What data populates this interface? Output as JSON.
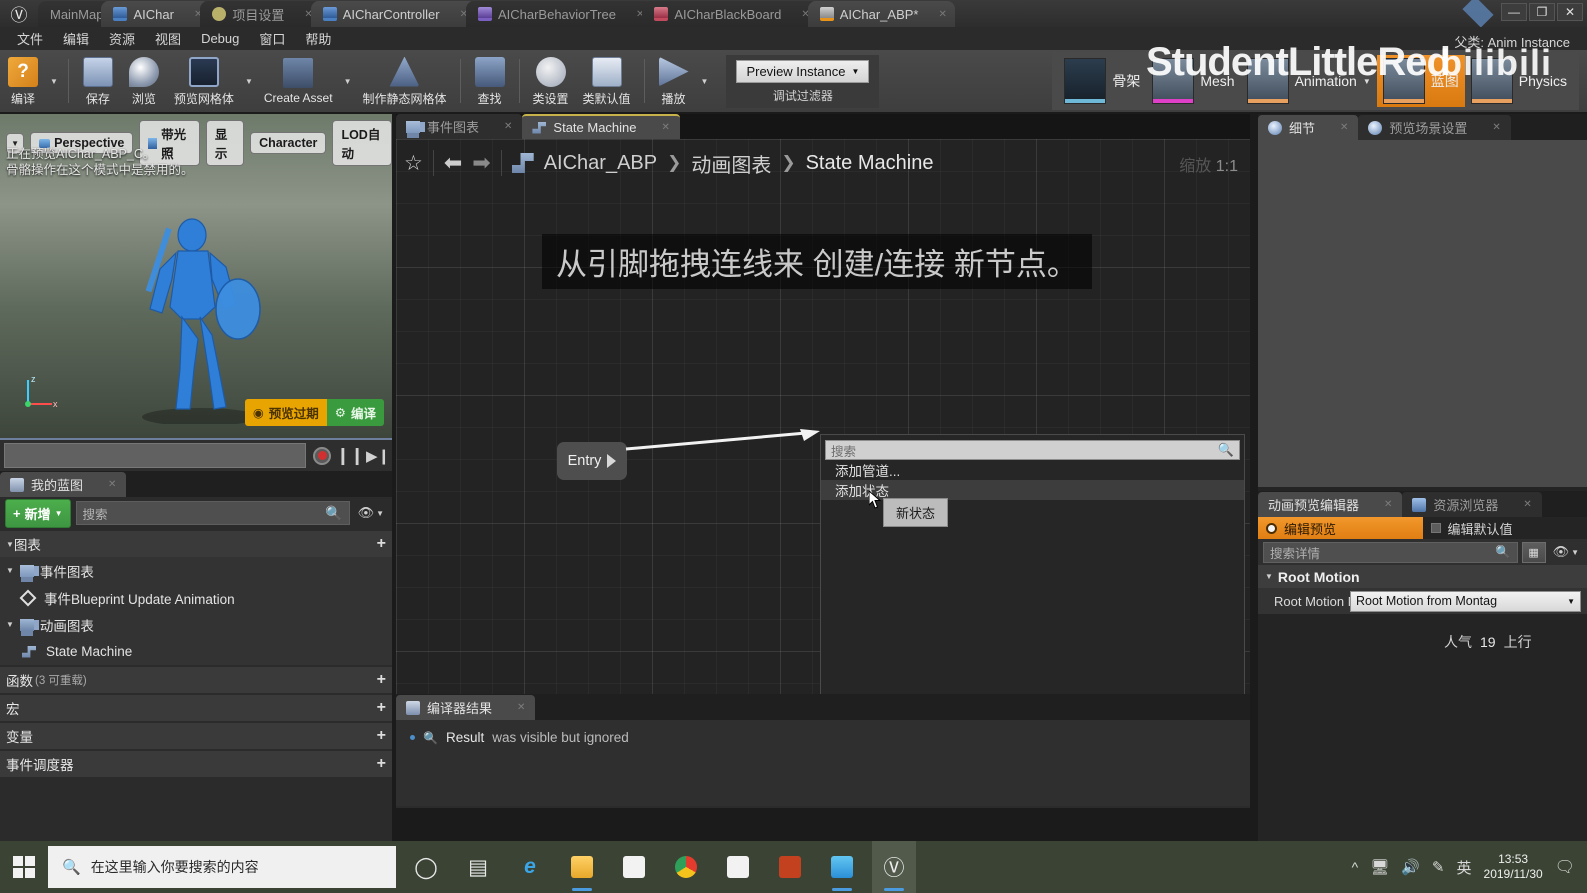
{
  "window": {
    "tabs": [
      {
        "label": "MainMap",
        "icon": "map-tab-icon",
        "active": false,
        "closable": false
      },
      {
        "label": "AIChar",
        "icon": "blueprint-tab-icon",
        "active": true,
        "closable": true
      },
      {
        "label": "项目设置",
        "icon": "settings-tab-icon",
        "active": false,
        "closable": true
      },
      {
        "label": "AICharController",
        "icon": "blueprint-tab-icon",
        "active": true,
        "closable": true
      },
      {
        "label": "AICharBehaviorTree",
        "icon": "behaviortree-tab-icon",
        "active": false,
        "closable": true
      },
      {
        "label": "AICharBlackBoard",
        "icon": "blackboard-tab-icon",
        "active": false,
        "closable": true
      },
      {
        "label": "AIChar_ABP*",
        "icon": "animbp-tab-icon",
        "active": true,
        "closable": true
      }
    ],
    "controls": {
      "minimize": "—",
      "maximize": "❐",
      "close": "✕"
    }
  },
  "menubar": {
    "items": [
      "文件",
      "编辑",
      "资源",
      "视图",
      "Debug",
      "窗口",
      "帮助"
    ],
    "right_label": "父类: Anim Instance"
  },
  "toolbar": {
    "items": [
      {
        "label": "编译",
        "icon": "compile-icon",
        "has_arrow": true
      },
      {
        "label": "保存",
        "icon": "save-icon",
        "has_arrow": false
      },
      {
        "label": "浏览",
        "icon": "browse-icon",
        "has_arrow": false
      },
      {
        "label": "预览网格体",
        "icon": "preview-mesh-icon",
        "has_arrow": true
      },
      {
        "label": "Create Asset",
        "icon": "create-asset-icon",
        "has_arrow": true
      },
      {
        "label": "制作静态网格体",
        "icon": "make-static-mesh-icon",
        "has_arrow": false
      },
      {
        "label": "查找",
        "icon": "find-icon",
        "has_arrow": false
      },
      {
        "label": "类设置",
        "icon": "class-settings-icon",
        "has_arrow": false
      },
      {
        "label": "类默认值",
        "icon": "class-defaults-icon",
        "has_arrow": false
      },
      {
        "label": "播放",
        "icon": "play-icon",
        "has_arrow": true
      }
    ],
    "preview_instance": {
      "value": "Preview Instance",
      "caption": "调试过滤器"
    },
    "modes": [
      {
        "label": "骨架",
        "active": false,
        "accent": "#6fb9d8"
      },
      {
        "label": "Mesh",
        "active": false,
        "accent": "#e040c8"
      },
      {
        "label": "Animation",
        "active": false,
        "accent": "#e8a060",
        "has_arrow": true
      },
      {
        "label": "蓝图",
        "active": true,
        "accent": "#e8a060"
      },
      {
        "label": "Physics",
        "active": false,
        "accent": "#e8a060"
      }
    ]
  },
  "watermark": {
    "text": "StudentLittleRed",
    "brand": "bilibili"
  },
  "viewport": {
    "buttons": [
      "Perspective",
      "带光照",
      "显示",
      "Character",
      "LOD自动"
    ],
    "info_lines": [
      "正在预览AIChar_ABP_C。",
      "骨骼操作在这个模式中是禁用的。"
    ],
    "gizmo": {
      "z": "z",
      "x": "x"
    },
    "badges": [
      {
        "label": "预览过期",
        "icon": "warning-icon",
        "color": "#e8a400"
      },
      {
        "label": "编译",
        "icon": "gear-icon",
        "color": "#3a9b3e"
      }
    ]
  },
  "my_blueprint": {
    "tab_label": "我的蓝图",
    "add_button": "新增",
    "search_placeholder": "搜索",
    "sections": [
      {
        "label": "图表",
        "sub": "",
        "plus": "+"
      },
      {
        "label": "函数",
        "sub": "(3 可重载)",
        "plus": "+"
      },
      {
        "label": "宏",
        "sub": "",
        "plus": "+"
      },
      {
        "label": "变量",
        "sub": "",
        "plus": "+"
      },
      {
        "label": "事件调度器",
        "sub": "",
        "plus": "+"
      }
    ],
    "graph_items": [
      {
        "label": "事件图表",
        "indent": 0,
        "icon": "event-graph-icon",
        "expandable": true
      },
      {
        "label": "事件Blueprint Update Animation",
        "indent": 1,
        "icon": "event-node-icon",
        "expandable": false
      },
      {
        "label": "动画图表",
        "indent": 0,
        "icon": "anim-graph-icon",
        "expandable": true
      },
      {
        "label": "State Machine",
        "indent": 1,
        "icon": "state-machine-icon",
        "expandable": false
      }
    ]
  },
  "graph": {
    "tabs": [
      {
        "label": "事件图表",
        "icon": "event-graph-icon",
        "active": false
      },
      {
        "label": "State Machine",
        "icon": "state-machine-icon",
        "active": true
      }
    ],
    "breadcrumb": [
      "AIChar_ABP",
      "动画图表",
      "State Machine"
    ],
    "zoom_label": "缩放",
    "zoom_value": "1:1",
    "hint": "从引脚拖拽连线来 创建/连接 新节点。",
    "entry_node": "Entry",
    "context_menu": {
      "search_placeholder": "搜索",
      "items": [
        {
          "label": "添加管道...",
          "highlighted": false
        },
        {
          "label": "添加状态",
          "highlighted": true
        }
      ],
      "tooltip": "新状态"
    }
  },
  "compiler_results": {
    "tab_label": "编译器结果",
    "messages": [
      {
        "icon": "find-result-icon",
        "key": "Result",
        "text": "was visible but ignored"
      }
    ]
  },
  "right_panel": {
    "top_tabs": [
      {
        "label": "细节",
        "icon": "details-icon",
        "active": true
      },
      {
        "label": "预览场景设置",
        "icon": "preview-scene-icon",
        "active": false
      }
    ],
    "anim_tabs": [
      {
        "label": "动画预览编辑器",
        "icon": "anim-preview-icon",
        "active": true
      },
      {
        "label": "资源浏览器",
        "icon": "asset-browser-icon",
        "active": false
      }
    ],
    "toggles": [
      {
        "label": "编辑预览",
        "on": true
      },
      {
        "label": "编辑默认值",
        "on": false
      }
    ],
    "search_placeholder": "搜索详情",
    "category": "Root Motion",
    "property": {
      "label": "Root Motion Mo",
      "value": "Root Motion from Montag"
    }
  },
  "popularity": {
    "label": "人气",
    "value": "19",
    "next": "上行"
  },
  "taskbar": {
    "search_placeholder": "在这里输入你要搜索的内容",
    "apps": [
      {
        "name": "cortana-icon",
        "glyph": "◯"
      },
      {
        "name": "task-view-icon",
        "glyph": "❏"
      },
      {
        "name": "edge-icon",
        "glyph": "e"
      },
      {
        "name": "file-explorer-icon",
        "glyph": "📁"
      },
      {
        "name": "microsoft-store-icon",
        "glyph": "🛍"
      },
      {
        "name": "chrome-icon",
        "glyph": "◉"
      },
      {
        "name": "snip-icon",
        "glyph": "✎"
      },
      {
        "name": "powerpoint-icon",
        "glyph": "P"
      },
      {
        "name": "live2d-icon",
        "glyph": "♪"
      },
      {
        "name": "unreal-icon",
        "glyph": "U"
      }
    ],
    "tray": [
      "^",
      "display",
      "volume",
      "pen",
      "英"
    ],
    "clock": {
      "time": "13:53",
      "date": "2019/11/30"
    }
  }
}
